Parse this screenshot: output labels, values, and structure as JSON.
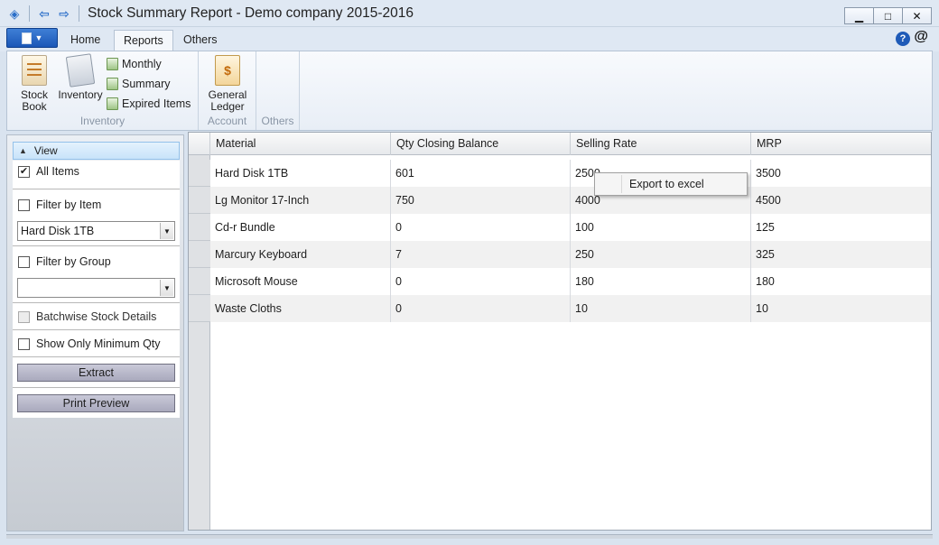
{
  "window": {
    "title": "Stock Summary Report - Demo company 2015-2016",
    "minimize": "▁",
    "maximize": "□",
    "close": "✕"
  },
  "ribbon": {
    "tabs": [
      {
        "label": "Home",
        "active": false
      },
      {
        "label": "Reports",
        "active": true
      },
      {
        "label": "Others",
        "active": false
      }
    ],
    "help": "?",
    "at": "@",
    "groups": {
      "inventory": {
        "label": "Inventory",
        "stock_book": "Stock\nBook",
        "inventory": "Inventory",
        "monthly": "Monthly",
        "summary": "Summary",
        "expired_items": "Expired Items"
      },
      "account": {
        "label": "Account",
        "general_ledger": "General\nLedger"
      },
      "others": {
        "label": "Others"
      }
    }
  },
  "panel": {
    "view_header": "View",
    "all_items": {
      "label": "All Items",
      "checked": true
    },
    "filter_by_item": {
      "label": "Filter by Item",
      "checked": false
    },
    "item_combo_value": "Hard Disk 1TB",
    "filter_by_group": {
      "label": "Filter by Group",
      "checked": false
    },
    "group_combo_value": "",
    "batchwise": {
      "label": "Batchwise Stock Details",
      "checked": false,
      "enabled": false
    },
    "min_qty": {
      "label": "Show Only Minimum Qty",
      "checked": false
    },
    "extract": "Extract",
    "print_preview": "Print Preview"
  },
  "grid": {
    "columns": [
      "Material",
      "Qty Closing Balance",
      "Selling Rate",
      "MRP"
    ],
    "rows": [
      [
        "Hard Disk 1TB",
        "601",
        "2500",
        "3500"
      ],
      [
        "Lg Monitor 17-Inch",
        "750",
        "4000",
        "4500"
      ],
      [
        "Cd-r Bundle",
        "0",
        "100",
        "125"
      ],
      [
        "Marcury Keyboard",
        "7",
        "250",
        "325"
      ],
      [
        "Microsoft Mouse",
        "0",
        "180",
        "180"
      ],
      [
        "Waste Cloths",
        "0",
        "10",
        "10"
      ]
    ]
  },
  "context_menu": {
    "items": [
      "Export to excel"
    ]
  }
}
